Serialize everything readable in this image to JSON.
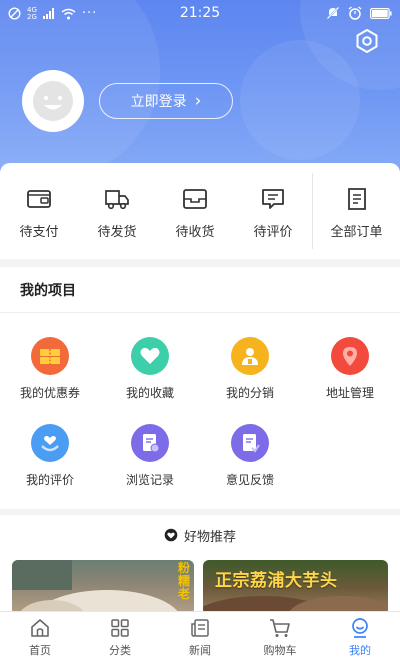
{
  "status_bar": {
    "net_top": "4G",
    "net_bottom": "2G",
    "time": "21:25",
    "dots": "···"
  },
  "header": {
    "login_label": "立即登录",
    "login_arrow": "›"
  },
  "orders": [
    {
      "label": "待支付",
      "icon": "wallet-icon"
    },
    {
      "label": "待发货",
      "icon": "truck-icon"
    },
    {
      "label": "待收货",
      "icon": "inbox-icon"
    },
    {
      "label": "待评价",
      "icon": "comment-icon"
    }
  ],
  "orders_all": {
    "label": "全部订单",
    "icon": "document-icon"
  },
  "projects": {
    "title": "我的项目",
    "items": [
      {
        "label": "我的优惠券",
        "icon": "coupon-icon",
        "color": "#f26a3a"
      },
      {
        "label": "我的收藏",
        "icon": "heart-icon",
        "color": "#3ccfa9"
      },
      {
        "label": "我的分销",
        "icon": "distribution-icon",
        "color": "#f6b31d"
      },
      {
        "label": "地址管理",
        "icon": "location-icon",
        "color": "#f24a3c"
      },
      {
        "label": "我的评价",
        "icon": "heart-hand-icon",
        "color": "#4a9df2"
      },
      {
        "label": "浏览记录",
        "icon": "history-icon",
        "color": "#7c6ce8"
      },
      {
        "label": "意见反馈",
        "icon": "feedback-icon",
        "color": "#7c6ce8"
      }
    ]
  },
  "recommend": {
    "title": "好物推荐",
    "left_tag": "粉糯老",
    "right_tag": "正宗荔浦大芋头"
  },
  "nav": [
    {
      "label": "首页",
      "icon": "home-icon"
    },
    {
      "label": "分类",
      "icon": "category-icon"
    },
    {
      "label": "新闻",
      "icon": "news-icon"
    },
    {
      "label": "购物车",
      "icon": "cart-icon"
    },
    {
      "label": "我的",
      "icon": "profile-icon"
    }
  ],
  "colors": {
    "accent": "#3b82f6",
    "header_top": "#5d86f0",
    "header_bottom": "#8eb1f8"
  }
}
